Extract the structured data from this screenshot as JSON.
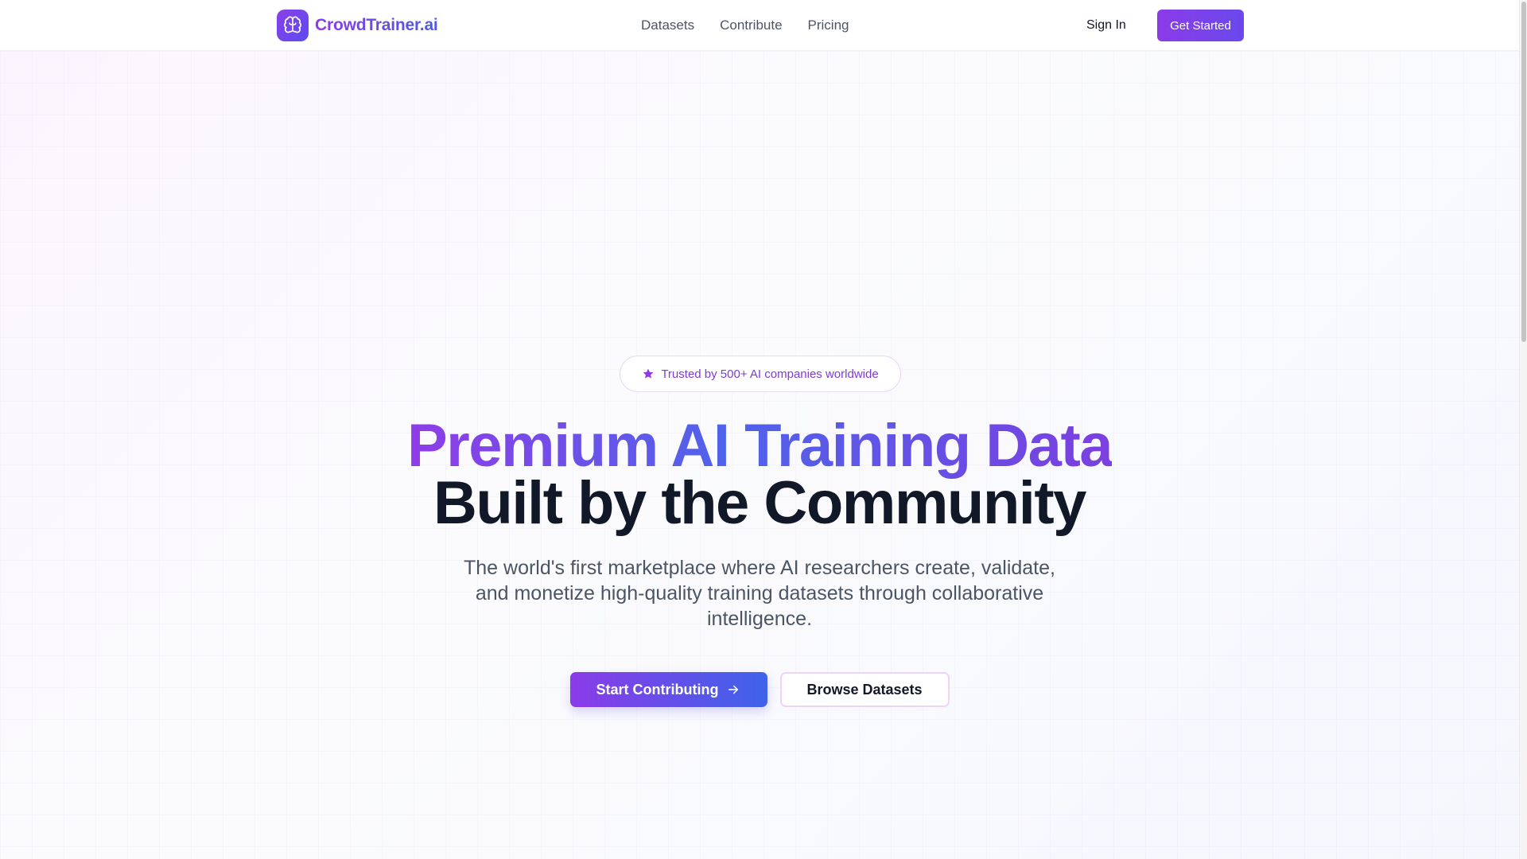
{
  "header": {
    "brand_name": "CrowdTrainer.ai",
    "brand_icon": "brain-icon",
    "nav": [
      {
        "label": "Datasets"
      },
      {
        "label": "Contribute"
      },
      {
        "label": "Pricing"
      }
    ],
    "sign_in_label": "Sign In",
    "get_started_label": "Get Started"
  },
  "hero": {
    "badge_icon": "star-icon",
    "badge_text": "Trusted by 500+ AI companies worldwide",
    "headline_line1": "Premium AI Training Data",
    "headline_line2": "Built by the Community",
    "subtitle": "The world's first marketplace where AI researchers create, validate, and monetize high-quality training datasets through collaborative intelligence.",
    "primary_cta": "Start Contributing",
    "primary_cta_icon": "arrow-right-icon",
    "secondary_cta": "Browse Datasets"
  },
  "colors": {
    "brand_purple": "#8b3be8",
    "brand_blue": "#4a5be8",
    "text_dark": "#111827",
    "text_muted": "#4b5563"
  }
}
